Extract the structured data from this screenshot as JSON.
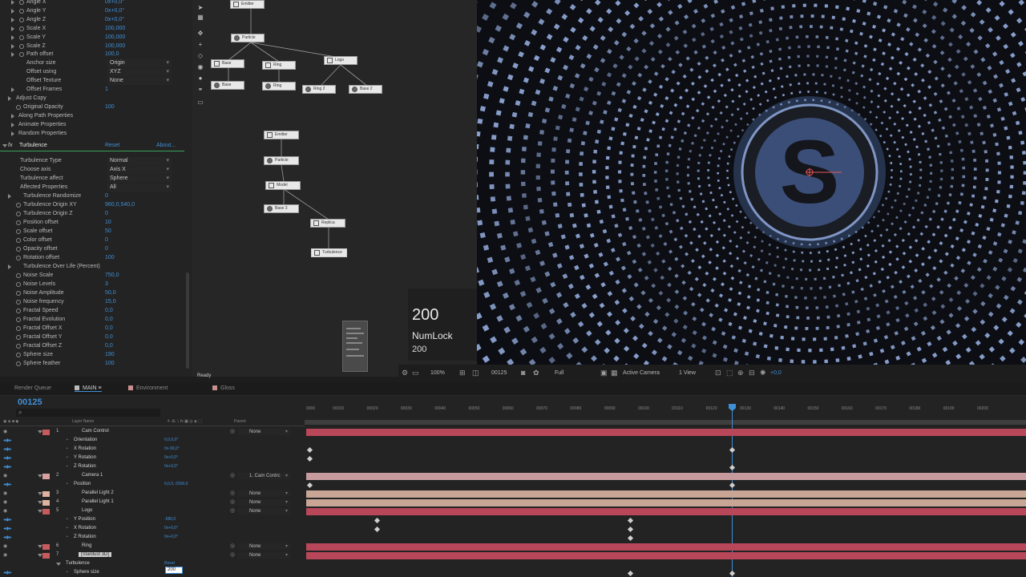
{
  "effect_controls": {
    "transform_props": [
      {
        "name": "Angle X",
        "value": "0x+0,0°",
        "indent": 3,
        "stopwatch": true
      },
      {
        "name": "Angle Y",
        "value": "0x+0,0°",
        "indent": 3,
        "stopwatch": true
      },
      {
        "name": "Angle Z",
        "value": "0x+0,0°",
        "indent": 3,
        "stopwatch": true
      },
      {
        "name": "Scale X",
        "value": "100,000",
        "indent": 3,
        "stopwatch": true
      },
      {
        "name": "Scale Y",
        "value": "100,000",
        "indent": 3,
        "stopwatch": true
      },
      {
        "name": "Scale Z",
        "value": "100,000",
        "indent": 3,
        "stopwatch": true
      },
      {
        "name": "Path offset",
        "value": "100,0",
        "indent": 3,
        "stopwatch": true
      }
    ],
    "anchor_size": {
      "name": "Anchor size",
      "value": "Origin"
    },
    "offset_using": {
      "name": "Offset using",
      "value": "XYZ"
    },
    "offset_texture": {
      "name": "Offset Texture",
      "value": "None"
    },
    "offset_frames": {
      "name": "Offset Frames",
      "value": "1"
    },
    "adjust_copy": "Adjust Copy",
    "original_opacity": {
      "name": "Original Opacity",
      "value": "100"
    },
    "groups": [
      "Along Path Properties",
      "Animate Properties",
      "Random Properties"
    ],
    "turbulence": {
      "icon": "fx",
      "name": "Turbulence",
      "reset": "Reset",
      "about": "About..."
    },
    "turb_props": [
      {
        "name": "Turbulence Type",
        "dropdown": "Normal"
      },
      {
        "name": "Choose axis",
        "dropdown": "Axis X"
      },
      {
        "name": "Turbulence affect",
        "dropdown": "Sphere"
      },
      {
        "name": "Affected Properties",
        "dropdown": "All"
      }
    ],
    "turb_params": [
      {
        "name": "Turbulence Randomize",
        "value": "0",
        "twirl": true
      },
      {
        "name": "Turbulence Origin XY",
        "value": "960,0,540,0",
        "stopwatch": true
      },
      {
        "name": "Turbulence Origin Z",
        "value": "0",
        "stopwatch": true
      },
      {
        "name": "Position offset",
        "value": "10",
        "stopwatch": true
      },
      {
        "name": "Scale offset",
        "value": "50",
        "stopwatch": true
      },
      {
        "name": "Color offset",
        "value": "0",
        "stopwatch": true
      },
      {
        "name": "Opacity offset",
        "value": "0",
        "stopwatch": true
      },
      {
        "name": "Rotation offset",
        "value": "100",
        "stopwatch": true
      },
      {
        "name": "Turbulence Over Life (Percent)",
        "value": "",
        "twirl": true
      },
      {
        "name": "Noise Scale",
        "value": "750,0",
        "stopwatch": true
      },
      {
        "name": "Noise Levels",
        "value": "3",
        "stopwatch": true
      },
      {
        "name": "Noise Amplitude",
        "value": "50,0",
        "stopwatch": true
      },
      {
        "name": "Noise frequency",
        "value": "15,0",
        "stopwatch": true
      },
      {
        "name": "Fractal Speed",
        "value": "0,0",
        "stopwatch": true
      },
      {
        "name": "Fractal Evolution",
        "value": "0,0",
        "stopwatch": true
      },
      {
        "name": "Fractal Offset X",
        "value": "0,0",
        "stopwatch": true
      },
      {
        "name": "Fractal Offset Y",
        "value": "0,0",
        "stopwatch": true
      },
      {
        "name": "Fractal Offset Z",
        "value": "0,0",
        "stopwatch": true
      },
      {
        "name": "Sphere size",
        "value": "190",
        "stopwatch": true
      },
      {
        "name": "Sphere feather",
        "value": "100",
        "stopwatch": true
      }
    ],
    "status": "Ready"
  },
  "node_graph": {
    "nodes_top": [
      "Emitter",
      "Particle",
      "Base",
      "Ring",
      "Logo",
      "Base",
      "Ring",
      "Ring 2",
      "Base 2"
    ],
    "nodes_bottom": [
      "Emitter",
      "Particle",
      "Model",
      "Base 3",
      "Replica",
      "Turbulence"
    ]
  },
  "key_overlay": {
    "big": "200",
    "name": "NumLock",
    "small": "200"
  },
  "viewer": {
    "logo_letter": "S",
    "colors": {
      "background": "#0c0e13",
      "dots": "#8fa6d6",
      "logo_ring": "#1a1d24",
      "logo_face": "#3b4e78"
    }
  },
  "viewer_bar": {
    "zoom": "100%",
    "time": "00125",
    "resolution": "Full",
    "camera": "Active Camera",
    "views": "1 View",
    "exposure": "+0,0"
  },
  "timeline": {
    "tabs": [
      {
        "label": "Render Queue",
        "color": ""
      },
      {
        "label": "MAIN",
        "color": "#bbbbbb",
        "active": true
      },
      {
        "label": "Environment",
        "color": "#c98f8f"
      },
      {
        "label": "Gloss",
        "color": "#c98f8f"
      }
    ],
    "timecode": "00125",
    "columns": {
      "layer_name": "Layer Name",
      "parent": "Parent"
    },
    "ruler_ticks": [
      "0000",
      "00010",
      "00020",
      "00030",
      "00040",
      "00050",
      "00060",
      "00070",
      "00080",
      "00090",
      "00100",
      "00110",
      "00120",
      "00130",
      "00140",
      "00150",
      "00160",
      "00170",
      "00180",
      "00190",
      "00200"
    ],
    "layers": [
      {
        "idx": "1",
        "name": "Cam Control",
        "label": "#c75b5b",
        "parent": "None",
        "kind": "layer"
      },
      {
        "name": "Orientation",
        "value": "0,0,0,0°",
        "kind": "prop"
      },
      {
        "name": "X Rotation",
        "value": "0x-90,0°",
        "kind": "prop"
      },
      {
        "name": "Y Rotation",
        "value": "0x+0,0°",
        "kind": "prop"
      },
      {
        "name": "Z Rotation",
        "value": "0x+0,0°",
        "kind": "prop"
      },
      {
        "idx": "2",
        "name": "Camera 1",
        "label": "#d9a0a0",
        "parent": "1. Cam Contrc",
        "kind": "layer"
      },
      {
        "name": "Position",
        "value": "0,0,0,-2500,0",
        "kind": "prop"
      },
      {
        "idx": "3",
        "name": "Parallel Light 2",
        "label": "#e0b0a0",
        "parent": "None",
        "kind": "layer"
      },
      {
        "idx": "4",
        "name": "Parallel Light 1",
        "label": "#e0b0a0",
        "parent": "None",
        "kind": "layer"
      },
      {
        "idx": "5",
        "name": "Logo",
        "label": "#c75b5b",
        "parent": "None",
        "kind": "layer"
      },
      {
        "name": "Y Position",
        "value": "-580,0",
        "kind": "prop"
      },
      {
        "name": "X Rotation",
        "value": "0x+0,0°",
        "kind": "prop"
      },
      {
        "name": "Z Rotation",
        "value": "0x+0,0°",
        "kind": "prop"
      },
      {
        "idx": "6",
        "name": "Ring",
        "label": "#c75b5b",
        "parent": "None",
        "kind": "layer"
      },
      {
        "idx": "7",
        "name": "[Stardust 3D]",
        "label": "#c75b5b",
        "parent": "None",
        "kind": "layer",
        "selected": true
      },
      {
        "name": "Turbulence",
        "value": "Reset",
        "kind": "group"
      },
      {
        "name": "Sphere size",
        "value": "200",
        "kind": "prop"
      }
    ],
    "bar_colors": {
      "red": "#b9475a",
      "pink": "#c79a9e",
      "peach": "#c9a596"
    }
  }
}
